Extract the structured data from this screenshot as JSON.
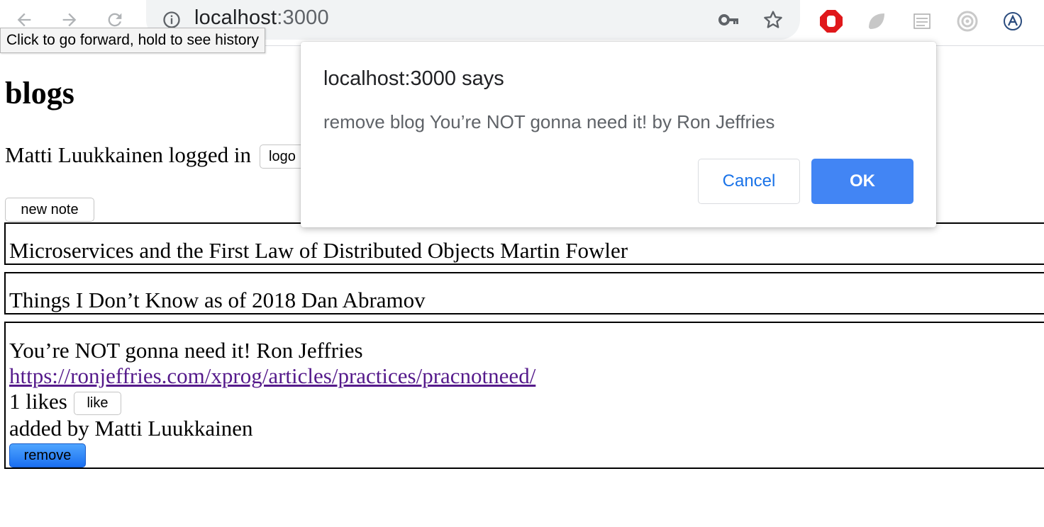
{
  "browser": {
    "url_host": "localhost",
    "url_port": ":3000",
    "tooltip": "Click to go forward, hold to see history"
  },
  "page": {
    "title": "blogs",
    "logged_in_user": "Matti Luukkainen logged in",
    "logout_label": "logo",
    "new_note_label": "new note"
  },
  "blogs": [
    {
      "title": "Microservices and the First Law of Distributed Objects Martin Fowler"
    },
    {
      "title": "Things I Don’t Know as of 2018 Dan Abramov"
    },
    {
      "title": "You’re NOT gonna need it! Ron Jeffries",
      "url": "https://ronjeffries.com/xprog/articles/practices/pracnotneed/",
      "likes": "1 likes",
      "like_label": "like",
      "added_by": "added by Matti Luukkainen",
      "remove_label": "remove"
    }
  ],
  "dialog": {
    "title": "localhost:3000 says",
    "message": "remove blog You’re NOT gonna need it! by Ron Jeffries",
    "cancel_label": "Cancel",
    "ok_label": "OK"
  },
  "colors": {
    "ok_button": "#4285f4",
    "cancel_text": "#1a73e8",
    "link_visited": "#551a8b",
    "remove_button": "#1a6ff0",
    "adblock_red": "#e0181b"
  },
  "icons": [
    "back-arrow-icon",
    "forward-arrow-icon",
    "reload-icon",
    "info-icon",
    "key-icon",
    "star-icon",
    "adblock-stop-icon",
    "extension-leaf-icon",
    "extension-notes-icon",
    "extension-target-icon",
    "extension-a-icon"
  ]
}
